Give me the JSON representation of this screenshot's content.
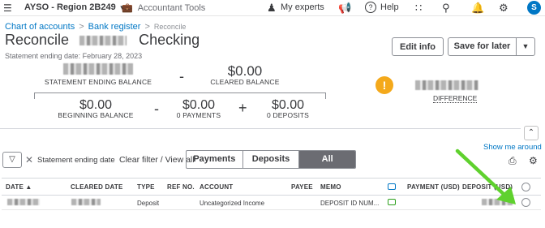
{
  "topbar": {
    "company": "AYSO - Region 2B249",
    "accountant_tools": "Accountant Tools",
    "my_experts": "My experts",
    "help": "Help",
    "avatar_initial": "S"
  },
  "breadcrumb": {
    "chart_of_accounts": "Chart of accounts",
    "bank_register": "Bank register",
    "current": "Reconcile"
  },
  "header": {
    "title_prefix": "Reconcile",
    "title_suffix": "Checking",
    "statement_date": "Statement ending date: February 28, 2023",
    "edit_info": "Edit info",
    "save_for_later": "Save for later"
  },
  "summary": {
    "statement_ending_balance_label": "STATEMENT ENDING BALANCE",
    "minus": "-",
    "cleared_balance_value": "$0.00",
    "cleared_balance_label": "CLEARED BALANCE",
    "beginning_balance_value": "$0.00",
    "beginning_balance_label": "BEGINNING BALANCE",
    "payments_value": "$0.00",
    "payments_label": "0 PAYMENTS",
    "plus": "+",
    "deposits_value": "$0.00",
    "deposits_label": "0 DEPOSITS",
    "difference_label": "DIFFERENCE"
  },
  "filters": {
    "chip_label": "Statement ending date",
    "clear_filter": "Clear filter / View all",
    "tabs": [
      "Payments",
      "Deposits",
      "All"
    ],
    "active_tab": "All",
    "show_me_around": "Show me around"
  },
  "table": {
    "columns": [
      "DATE ▲",
      "CLEARED DATE",
      "TYPE",
      "REF NO.",
      "ACCOUNT",
      "PAYEE",
      "MEMO",
      "PAYMENT (USD)",
      "DEPOSIT (USD)"
    ],
    "rows": [
      {
        "date": "",
        "cleared_date": "",
        "type": "Deposit",
        "ref_no": "",
        "account": "Uncategorized Income",
        "payee": "",
        "memo": "DEPOSIT ID NUM...",
        "payment": "",
        "deposit": ""
      }
    ]
  },
  "colors": {
    "link": "#0077c5",
    "warning": "#f4a91b",
    "arrow": "#5fd12e",
    "segment_active": "#6b6c72",
    "avatar": "#0077c5"
  },
  "icons": {
    "menu": "hamburger-icon",
    "tools": "briefcase-icon",
    "experts": "person-icon",
    "announce": "megaphone-icon",
    "help": "help-icon",
    "apps": "grid-icon",
    "search": "search-icon",
    "notifications": "bell-icon",
    "settings": "gear-icon",
    "warning": "warning-icon",
    "filter": "funnel-icon",
    "print": "printer-icon"
  }
}
